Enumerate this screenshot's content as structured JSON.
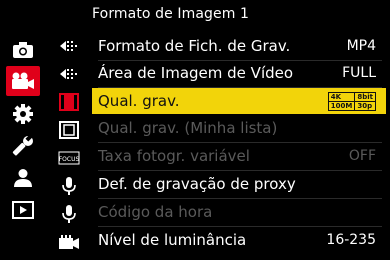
{
  "header": {
    "title": "Formato de Imagem 1"
  },
  "main_categories": [
    {
      "icon": "camera-icon",
      "active": false
    },
    {
      "icon": "video-camera-icon",
      "active": true
    },
    {
      "icon": "gear-icon",
      "active": false
    },
    {
      "icon": "wrench-icon",
      "active": false
    },
    {
      "icon": "person-icon",
      "active": false
    },
    {
      "icon": "playback-icon",
      "active": false
    }
  ],
  "sub_tabs": [
    {
      "icon": "image-format-icon",
      "label": ""
    },
    {
      "icon": "image-format-icon",
      "label": ""
    },
    {
      "icon": "film-icon",
      "label": ""
    },
    {
      "icon": "film-frame-icon",
      "label": ""
    },
    {
      "icon": "focus-icon",
      "label": "FOCUS"
    },
    {
      "icon": "microphone-icon",
      "label": ""
    },
    {
      "icon": "microphone-icon",
      "label": ""
    },
    {
      "icon": "monitor-film-icon",
      "label": ""
    }
  ],
  "menu": {
    "items": [
      {
        "label": "Formato de Fich. de Grav.",
        "value": "MP4",
        "state": "normal"
      },
      {
        "label": "Área de Imagem de Vídeo",
        "value": "FULL",
        "state": "normal"
      },
      {
        "label": "Qual. grav.",
        "value": "",
        "state": "selected",
        "badge": {
          "res": "4K",
          "bit": "8bit",
          "rate": "100M",
          "fps": "30p"
        }
      },
      {
        "label": "Qual. grav. (Minha lista)",
        "value": "",
        "state": "disabled"
      },
      {
        "label": "Taxa fotogr. variável",
        "value": "OFF",
        "state": "disabled"
      },
      {
        "label": "Def. de gravação de proxy",
        "value": "",
        "state": "normal"
      },
      {
        "label": "Código da hora",
        "value": "",
        "state": "disabled"
      },
      {
        "label": "Nível de luminância",
        "value": "16-235",
        "state": "normal"
      }
    ]
  },
  "colors": {
    "accent_red": "#e0001a",
    "highlight_yellow": "#f2d40a",
    "disabled_gray": "#5a5a5a"
  }
}
